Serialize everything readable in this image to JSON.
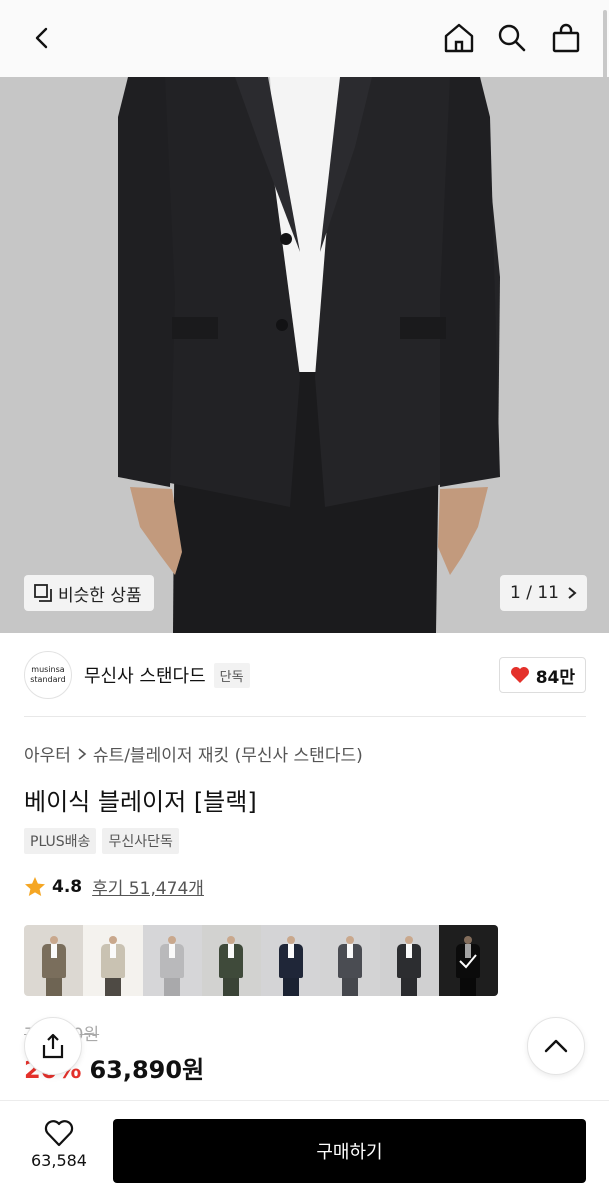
{
  "header": {
    "back_icon": "chevron-left-icon",
    "home_icon": "home-icon",
    "search_icon": "search-icon",
    "cart_icon": "shopping-bag-icon"
  },
  "gallery": {
    "similar_label": "비슷한 상품",
    "counter": "1 / 11"
  },
  "brand": {
    "logo_line1": "musinsa",
    "logo_line2": "standard",
    "name": "무신사 스탠다드",
    "tag": "단독",
    "likes": "84만"
  },
  "product": {
    "breadcrumb": [
      "아우터",
      "슈트/블레이저 재킷 (무신사 스탠다드)"
    ],
    "title": "베이식 블레이저 [블랙]",
    "badges": [
      "PLUS배송",
      "무신사단독"
    ],
    "rating": "4.8",
    "reviews": "후기 51,474개"
  },
  "swatches": [
    {
      "name": "khaki-brown",
      "color": "#7a6e5c",
      "bg": "#dcd8d2",
      "legs": "#6e6453"
    },
    {
      "name": "beige",
      "color": "#c9c2b2",
      "bg": "#f4f2ee",
      "legs": "#4e4a44"
    },
    {
      "name": "light-gray",
      "color": "#b9b9bb",
      "bg": "#d6d6d8",
      "legs": "#a9a9ab"
    },
    {
      "name": "olive",
      "color": "#3f4a3a",
      "bg": "#d2d2d0",
      "legs": "#3a4336"
    },
    {
      "name": "navy",
      "color": "#1f2638",
      "bg": "#d4d4d6",
      "legs": "#1b2232"
    },
    {
      "name": "charcoal",
      "color": "#4a4c52",
      "bg": "#d3d3d4",
      "legs": "#45474c"
    },
    {
      "name": "dark-gray",
      "color": "#2c2d30",
      "bg": "#d0d0d1",
      "legs": "#2a2b2e"
    },
    {
      "name": "black",
      "color": "#111111",
      "bg": "#2e2e2e",
      "legs": "#0e0e0e",
      "selected": true
    }
  ],
  "price": {
    "original": "79,890원",
    "discount": "20%",
    "current": "63,890원"
  },
  "bottom": {
    "wish_count": "63,584",
    "buy_label": "구매하기"
  }
}
